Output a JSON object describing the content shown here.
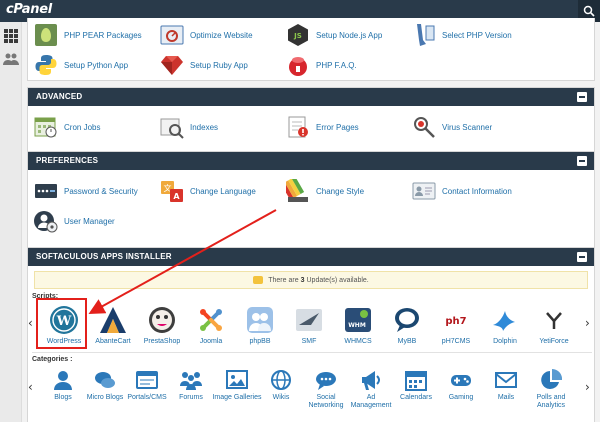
{
  "topbar": {
    "logo": "cPanel"
  },
  "software": {
    "items": [
      {
        "label": "PHP PEAR Packages",
        "icon": "php-pear-icon"
      },
      {
        "label": "Optimize Website",
        "icon": "optimize-icon"
      },
      {
        "label": "Setup Node.js App",
        "icon": "nodejs-icon"
      },
      {
        "label": "Select PHP Version",
        "icon": "php-version-icon"
      },
      {
        "label": "Setup Python App",
        "icon": "python-icon"
      },
      {
        "label": "Setup Ruby App",
        "icon": "ruby-icon"
      },
      {
        "label": "PHP F.A.Q.",
        "icon": "php-faq-icon"
      }
    ]
  },
  "advanced": {
    "title": "ADVANCED",
    "items": [
      {
        "label": "Cron Jobs",
        "icon": "cron-icon"
      },
      {
        "label": "Indexes",
        "icon": "indexes-icon"
      },
      {
        "label": "Error Pages",
        "icon": "error-pages-icon"
      },
      {
        "label": "Virus Scanner",
        "icon": "virus-scanner-icon"
      }
    ]
  },
  "preferences": {
    "title": "PREFERENCES",
    "items": [
      {
        "label": "Password & Security",
        "icon": "password-icon"
      },
      {
        "label": "Change Language",
        "icon": "language-icon"
      },
      {
        "label": "Change Style",
        "icon": "style-icon"
      },
      {
        "label": "Contact Information",
        "icon": "contact-icon"
      },
      {
        "label": "User Manager",
        "icon": "user-manager-icon"
      }
    ]
  },
  "softaculous": {
    "title": "SOFTACULOUS APPS INSTALLER",
    "notice_prefix": "There are",
    "notice_count": "3",
    "notice_suffix": "Update(s) available.",
    "scripts_label": "Scripts:",
    "categories_label": "Categories :",
    "scripts": [
      {
        "label": "WordPress",
        "color": "#21759b"
      },
      {
        "label": "AbanteCart",
        "color": "#1a3d6b"
      },
      {
        "label": "PrestaShop",
        "color": "#df0067"
      },
      {
        "label": "Joomla",
        "color": "#f44321"
      },
      {
        "label": "phpBB",
        "color": "#5b8fd1"
      },
      {
        "label": "SMF",
        "color": "#4a5a6a"
      },
      {
        "label": "WHMCS",
        "color": "#2a4d77"
      },
      {
        "label": "MyBB",
        "color": "#1b4770"
      },
      {
        "label": "pH7CMS",
        "color": "#b3161b"
      },
      {
        "label": "Dolphin",
        "color": "#2f8ad8"
      },
      {
        "label": "YetiForce",
        "color": "#333333"
      }
    ],
    "categories": [
      {
        "label": "Blogs"
      },
      {
        "label": "Micro Blogs"
      },
      {
        "label": "Portals/CMS"
      },
      {
        "label": "Forums"
      },
      {
        "label": "Image Galleries"
      },
      {
        "label": "Wikis"
      },
      {
        "label": "Social Networking"
      },
      {
        "label": "Ad Management"
      },
      {
        "label": "Calendars"
      },
      {
        "label": "Gaming"
      },
      {
        "label": "Mails"
      },
      {
        "label": "Polls and Analytics"
      }
    ]
  },
  "colors": {
    "header": "#293a4a",
    "link": "#1f6fa8",
    "accent_red": "#e3201b"
  }
}
